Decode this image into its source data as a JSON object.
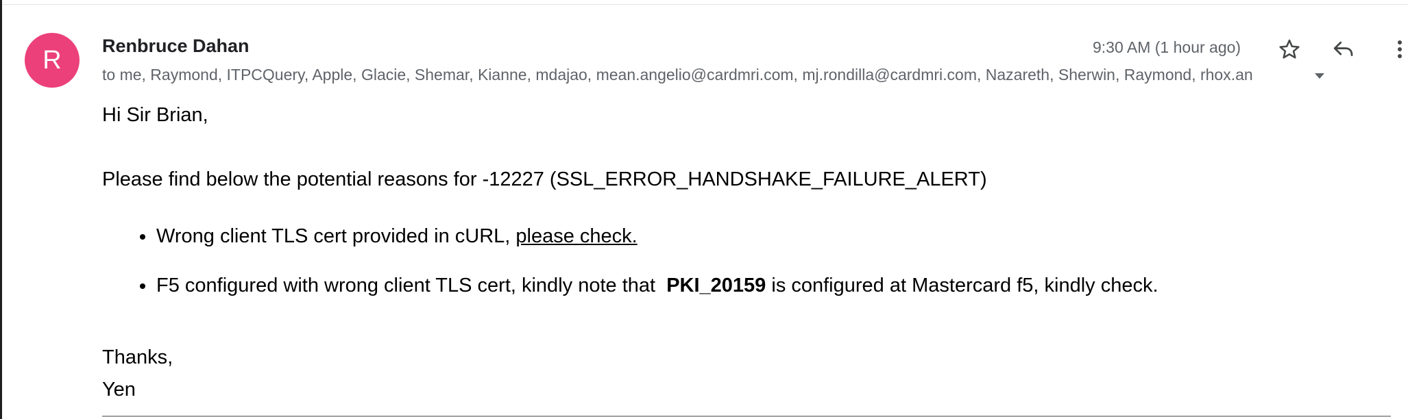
{
  "email": {
    "sender_name": "Renbruce Dahan",
    "avatar_letter": "R",
    "avatar_color": "#ec407a",
    "recipients": "to me, Raymond, ITPCQuery, Apple, Glacie, Shemar, Kianne, mdajao, mean.angelio@cardmri.com, mj.rondilla@cardmri.com, Nazareth, Sherwin, Raymond, rhox.an",
    "timestamp": "9:30 AM (1 hour ago)",
    "icons": {
      "star": "star-icon",
      "reply": "reply-icon",
      "more": "more-vert-icon",
      "recipients_dropdown": "chevron-down-icon"
    }
  },
  "body": {
    "greeting": "Hi Sir Brian,",
    "intro": "Please find below the potential reasons for -12227 (SSL_ERROR_HANDSHAKE_FAILURE_ALERT)",
    "bullet1": {
      "text": "Wrong client TLS cert provided in cURL, ",
      "link": "please check."
    },
    "bullet2": {
      "before": "F5 configured with wrong client TLS cert, kindly note that  ",
      "bold": "PKI_20159",
      "after": " is configured at Mastercard f5, kindly check."
    },
    "thanks": "Thanks,",
    "signature": "Yen"
  }
}
